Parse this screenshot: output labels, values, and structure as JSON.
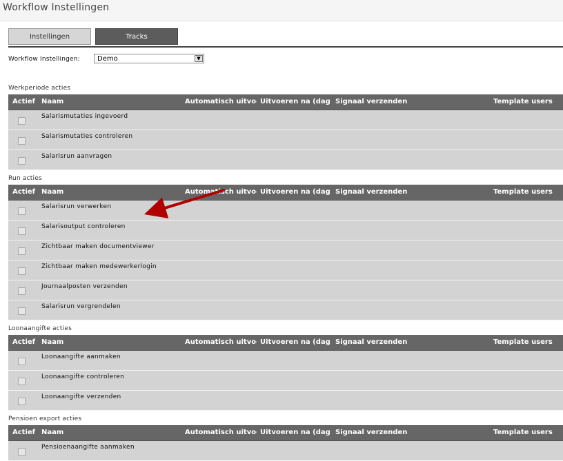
{
  "window": {
    "title": "Workflow Instellingen"
  },
  "tabs": [
    {
      "label": "Instellingen",
      "active": false
    },
    {
      "label": "Tracks",
      "active": true
    }
  ],
  "settings": {
    "label": "Workflow Instellingen:",
    "selected": "Demo"
  },
  "columns": {
    "actief": "Actief",
    "naam": "Naam",
    "automatisch": "Automatisch uitvoeren",
    "uitvoeren_na": "Uitvoeren na (dagen)",
    "signaal": "Signaal verzenden",
    "template_users": "Template users"
  },
  "sections": [
    {
      "title": "Werkperiode acties",
      "rows": [
        "Salarismutaties ingevoerd",
        "Salarismutaties controleren",
        "Salarisrun aanvragen"
      ]
    },
    {
      "title": "Run acties",
      "rows": [
        "Salarisrun verwerken",
        "Salarisoutput controleren",
        "Zichtbaar maken documentviewer",
        "Zichtbaar maken medewerkerlogin",
        "Journaalposten verzenden",
        "Salarisrun vergrendelen"
      ]
    },
    {
      "title": "Loonaangifte acties",
      "rows": [
        "Loonaangifte aanmaken",
        "Loonaangifte controleren",
        "Loonaangifte verzenden"
      ]
    },
    {
      "title": "Pensioen export acties",
      "rows": [
        "Pensioenaangifte aanmaken"
      ]
    }
  ],
  "colors": {
    "header_bg": "#666666",
    "row_bg": "#d3d3d3",
    "annotation_arrow": "#b00000"
  }
}
